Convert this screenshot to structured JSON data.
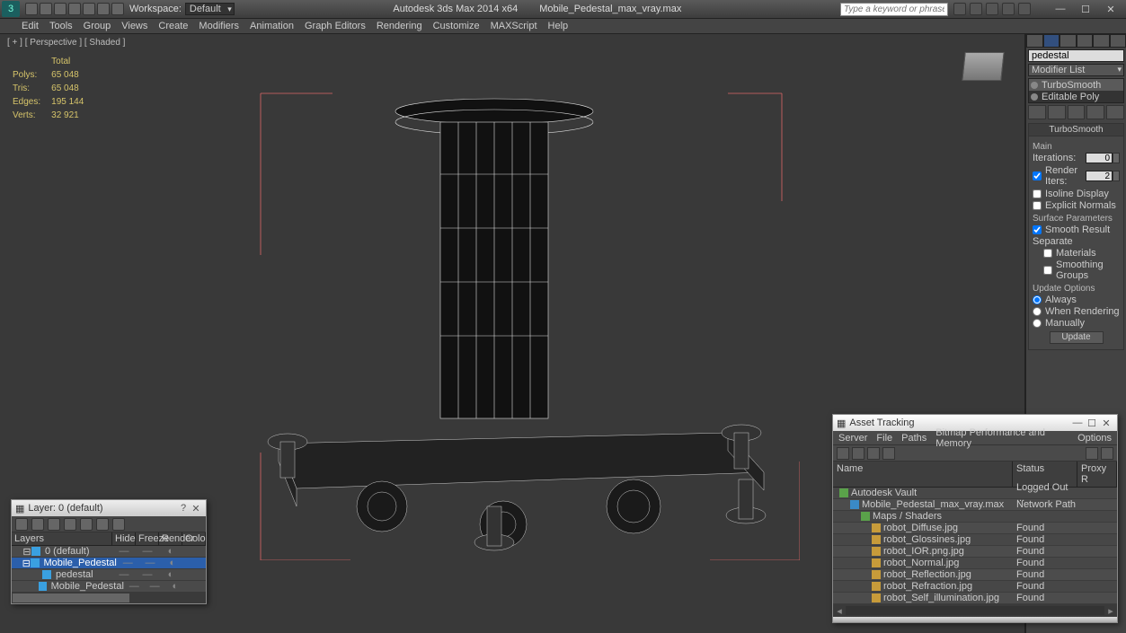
{
  "title": {
    "app": "Autodesk 3ds Max  2014 x64",
    "file": "Mobile_Pedestal_max_vray.max"
  },
  "workspace": {
    "label": "Workspace:",
    "value": "Default"
  },
  "search": {
    "placeholder": "Type a keyword or phrase"
  },
  "menus": [
    "Edit",
    "Tools",
    "Group",
    "Views",
    "Create",
    "Modifiers",
    "Animation",
    "Graph Editors",
    "Rendering",
    "Customize",
    "MAXScript",
    "Help"
  ],
  "viewport": {
    "label": "[ + ] [ Perspective ] [ Shaded ]",
    "stats": {
      "header": "Total",
      "rows": [
        {
          "k": "Polys:",
          "v": "65 048"
        },
        {
          "k": "Tris:",
          "v": "65 048"
        },
        {
          "k": "Edges:",
          "v": "195 144"
        },
        {
          "k": "Verts:",
          "v": "32 921"
        }
      ]
    }
  },
  "cmd": {
    "objname": "pedestal",
    "modlist": "Modifier List",
    "stack": [
      "TurboSmooth",
      "Editable Poly"
    ],
    "rollout_title": "TurboSmooth",
    "main_label": "Main",
    "iterations_label": "Iterations:",
    "iterations_val": "0",
    "render_iters_label": "Render Iters:",
    "render_iters_val": "2",
    "isoline": "Isoline Display",
    "explicit": "Explicit Normals",
    "surface_label": "Surface Parameters",
    "smooth_result": "Smooth Result",
    "separate": "Separate",
    "sep_materials": "Materials",
    "sep_smgroups": "Smoothing Groups",
    "update_label": "Update Options",
    "upd_always": "Always",
    "upd_render": "When Rendering",
    "upd_manual": "Manually",
    "update_btn": "Update"
  },
  "layers": {
    "title": "Layer: 0 (default)",
    "cols": {
      "layers": "Layers",
      "hide": "Hide",
      "freeze": "Freeze",
      "render": "Render",
      "color": "Colo"
    },
    "rows": [
      {
        "name": "0 (default)",
        "indent": 1,
        "sel": false,
        "color": "#5a5ad0",
        "type": "layer"
      },
      {
        "name": "Mobile_Pedestal",
        "indent": 1,
        "sel": true,
        "color": "#7ac943",
        "type": "layer"
      },
      {
        "name": "pedestal",
        "indent": 2,
        "sel": false,
        "color": "#7ac943",
        "type": "obj"
      },
      {
        "name": "Mobile_Pedestal",
        "indent": 2,
        "sel": false,
        "color": "#7ac943",
        "type": "obj"
      }
    ]
  },
  "asset": {
    "title": "Asset Tracking",
    "menus": [
      "Server",
      "File",
      "Paths",
      "Bitmap Performance and Memory",
      "Options"
    ],
    "cols": {
      "name": "Name",
      "status": "Status",
      "proxy": "Proxy R"
    },
    "rows": [
      {
        "name": "Autodesk Vault",
        "status": "Logged Out ...",
        "indent": 0,
        "icon": "grn"
      },
      {
        "name": "Mobile_Pedestal_max_vray.max",
        "status": "Network Path",
        "indent": 1,
        "icon": "blue"
      },
      {
        "name": "Maps / Shaders",
        "status": "",
        "indent": 2,
        "icon": "grn"
      },
      {
        "name": "robot_Diffuse.jpg",
        "status": "Found",
        "indent": 3,
        "icon": ""
      },
      {
        "name": "robot_Glossines.jpg",
        "status": "Found",
        "indent": 3,
        "icon": ""
      },
      {
        "name": "robot_IOR.png.jpg",
        "status": "Found",
        "indent": 3,
        "icon": ""
      },
      {
        "name": "robot_Normal.jpg",
        "status": "Found",
        "indent": 3,
        "icon": ""
      },
      {
        "name": "robot_Reflection.jpg",
        "status": "Found",
        "indent": 3,
        "icon": ""
      },
      {
        "name": "robot_Refraction.jpg",
        "status": "Found",
        "indent": 3,
        "icon": ""
      },
      {
        "name": "robot_Self_illumination.jpg",
        "status": "Found",
        "indent": 3,
        "icon": ""
      }
    ]
  }
}
